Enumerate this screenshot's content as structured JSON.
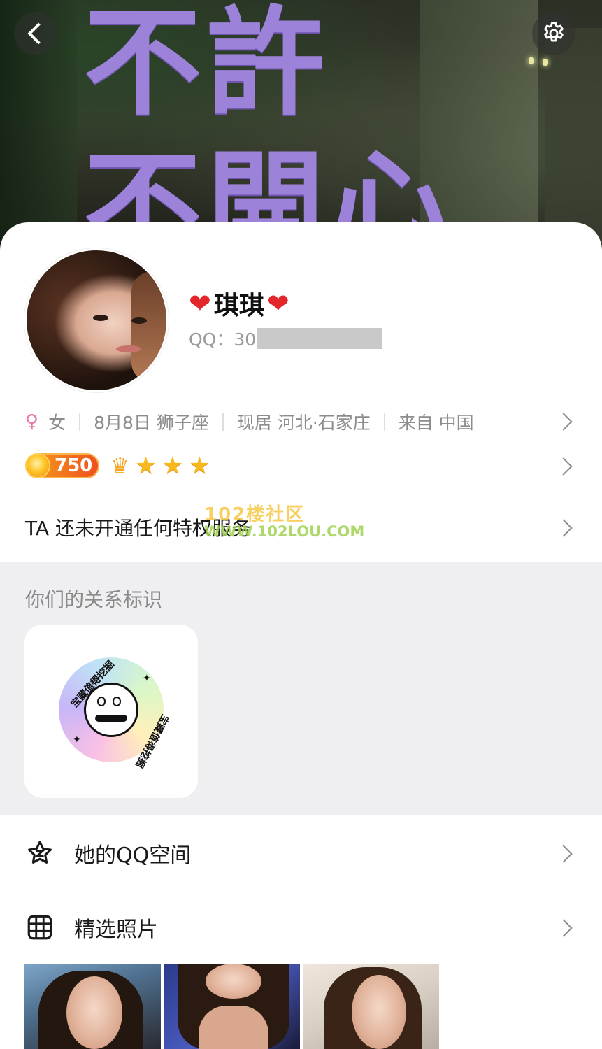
{
  "header": {
    "cover_line1": "不許",
    "cover_line2": "不開心",
    "back_icon": "back-chevron-icon",
    "settings_icon": "gear-icon"
  },
  "profile": {
    "name": "琪琪",
    "name_decoration": "❤️",
    "qq_label": "QQ：30",
    "qq_redacted": true,
    "gender": "女",
    "birthday": "8月8日 狮子座",
    "residence": "现居 河北·石家庄",
    "origin": "来自 中国",
    "level": "750",
    "privilege_text": "TA 还未开通任何特权服务"
  },
  "watermark": {
    "line1": "102楼社区",
    "line2": "WWW.102LOU.COM"
  },
  "relationship": {
    "title": "你们的关系标识",
    "badge_text_top": "宝藏值得挖掘",
    "badge_text_right": "宝藏值得挖掘"
  },
  "list": {
    "qzone_label": "她的QQ空间",
    "photos_label": "精选照片"
  },
  "colors": {
    "accent_purple": "#9c83d9",
    "level_orange": "#ef4f1f",
    "star_gold": "#f8b91f",
    "female_pink": "#e877a8",
    "section_gray": "#efeff2"
  }
}
